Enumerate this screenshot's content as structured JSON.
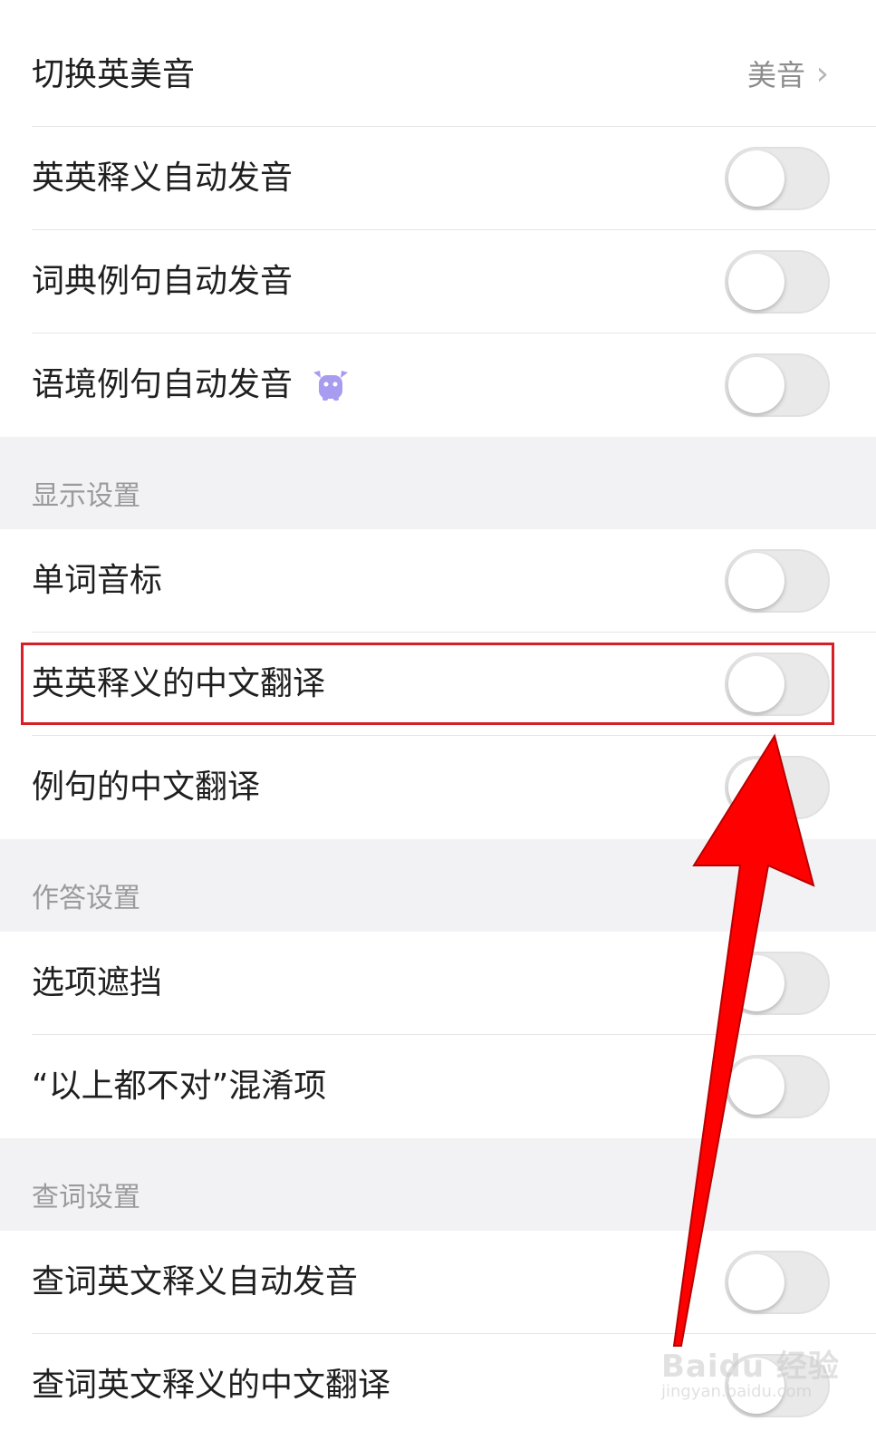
{
  "rows_top": [
    {
      "label": "切换英美音",
      "value": "美音"
    },
    {
      "label": "英英释义自动发音",
      "toggle_on": false
    },
    {
      "label": "词典例句自动发音",
      "toggle_on": false
    },
    {
      "label": "语境例句自动发音",
      "toggle_on": false,
      "badge": "mascot-icon"
    }
  ],
  "sections": [
    {
      "title": "显示设置",
      "items": [
        {
          "label": "单词音标",
          "toggle_on": false
        },
        {
          "label": "英英释义的中文翻译",
          "toggle_on": false,
          "highlighted": true
        },
        {
          "label": "例句的中文翻译",
          "toggle_on": false
        }
      ]
    },
    {
      "title": "作答设置",
      "items": [
        {
          "label": "选项遮挡",
          "toggle_on": false
        },
        {
          "label": "“以上都不对”混淆项",
          "toggle_on": false
        }
      ]
    },
    {
      "title": "查词设置",
      "items": [
        {
          "label": "查词英文释义自动发音",
          "toggle_on": false
        },
        {
          "label": "查词英文释义的中文翻译",
          "toggle_on": false
        }
      ]
    }
  ],
  "annotation": {
    "highlight_color": "#d71f26",
    "arrow_color": "#ff0000"
  },
  "watermark": {
    "line1": "Baidu 经验",
    "line2": "jingyan.baidu.com"
  },
  "colors": {
    "section_bg": "#f2f2f4",
    "section_text": "#9a9a9a",
    "toggle_off": "#e9e9ea",
    "mascot": "#a89cf0"
  }
}
